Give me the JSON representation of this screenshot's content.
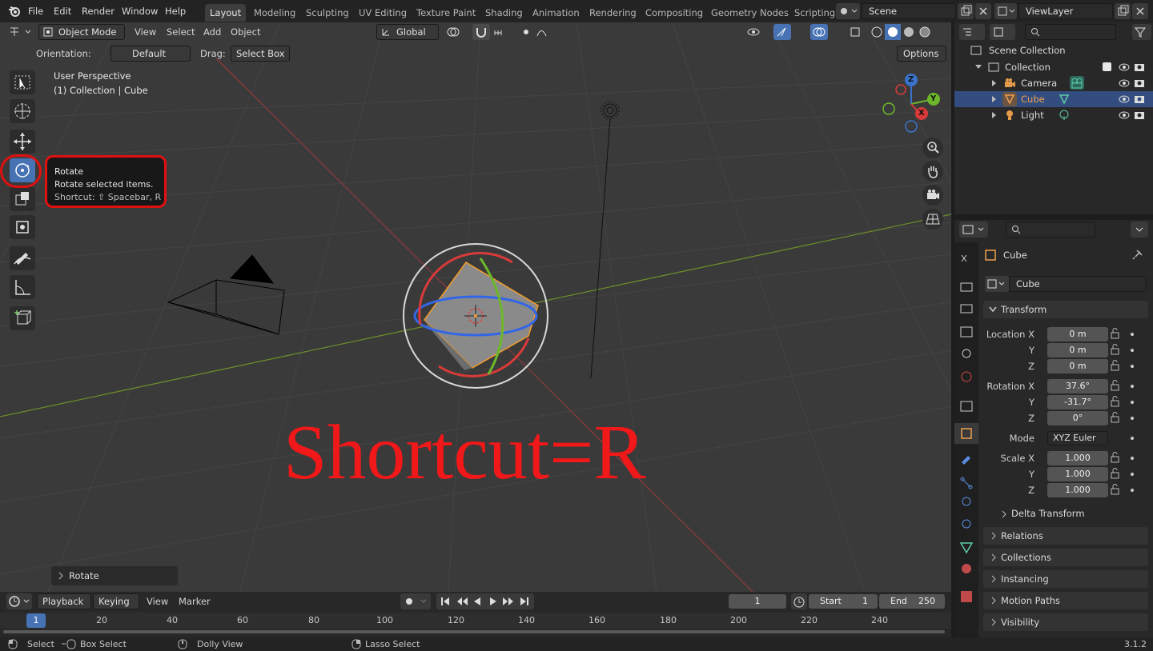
{
  "menu": [
    "File",
    "Edit",
    "Render",
    "Window",
    "Help"
  ],
  "workspaces": [
    "Layout",
    "Modeling",
    "Sculpting",
    "UV Editing",
    "Texture Paint",
    "Shading",
    "Animation",
    "Rendering",
    "Compositing",
    "Geometry Nodes",
    "Scripting"
  ],
  "scene": "Scene",
  "view_layer": "ViewLayer",
  "viewport": {
    "mode": "Object Mode",
    "menus": [
      "View",
      "Select",
      "Add",
      "Object"
    ],
    "transform_orientation": "Global",
    "orientation_label": "Orientation:",
    "orientation_value": "Default",
    "drag_label": "Drag:",
    "drag_value": "Select Box",
    "options": "Options",
    "perspective": "User Perspective",
    "context": "(1) Collection | Cube",
    "annotation": "Shortcut=R",
    "last_op": "Rotate"
  },
  "tooltip": {
    "title": "Rotate",
    "desc": "Rotate selected items.",
    "shortcut": "Shortcut: ⇧ Spacebar, R"
  },
  "gizmo_axes": {
    "x": "X",
    "y": "Y",
    "z": "Z"
  },
  "outliner": {
    "root": "Scene Collection",
    "collection": "Collection",
    "items": [
      "Camera",
      "Cube",
      "Light"
    ]
  },
  "properties": {
    "object_name": "Cube",
    "data_name": "Cube",
    "transform_title": "Transform",
    "location_label": "Location X",
    "location": [
      "0 m",
      "0 m",
      "0 m"
    ],
    "rotation_label": "Rotation X",
    "rotation": [
      "37.6°",
      "-31.7°",
      "0°"
    ],
    "mode_label": "Mode",
    "mode": "XYZ Euler",
    "scale_label": "Scale X",
    "scale": [
      "1.000",
      "1.000",
      "1.000"
    ],
    "axis_y": "Y",
    "axis_z": "Z",
    "delta": "Delta Transform",
    "panels": [
      "Relations",
      "Collections",
      "Instancing",
      "Motion Paths",
      "Visibility"
    ]
  },
  "timeline": {
    "menus": [
      "Playback",
      "Keying",
      "View",
      "Marker"
    ],
    "current_frame": "1",
    "start_label": "Start",
    "start": "1",
    "end_label": "End",
    "end": "250",
    "ticks": [
      "1",
      "20",
      "40",
      "60",
      "80",
      "100",
      "120",
      "140",
      "160",
      "180",
      "200",
      "220",
      "240"
    ]
  },
  "status": {
    "select": "Select",
    "box_select": "Box Select",
    "dolly": "Dolly View",
    "lasso": "Lasso Select",
    "version": "3.1.2"
  }
}
